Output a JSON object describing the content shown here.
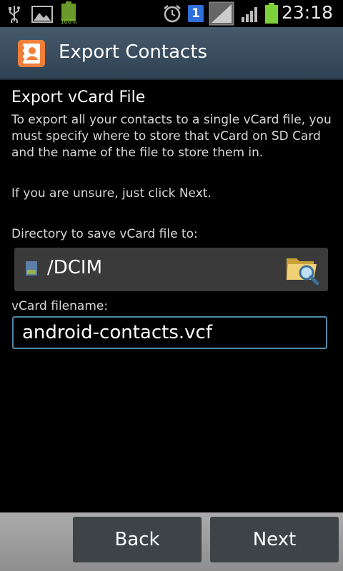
{
  "status_bar": {
    "time": "23:18",
    "battery_level": "100%",
    "notification_count": "1",
    "icons": [
      "usb-icon",
      "image-icon",
      "battery-notification-icon",
      "alarm-icon",
      "notification-badge-icon",
      "wifi-icon",
      "signal-icon",
      "battery-icon"
    ]
  },
  "header": {
    "title": "Export Contacts",
    "icon": "contacts-app-icon",
    "accent_color": "#f07f3c"
  },
  "main": {
    "heading": "Export vCard File",
    "description": "To export all your contacts to a single vCard file, you must specify where to store that vCard on SD Card and the name of the file to store them in.",
    "hint": "If you are unsure, just click Next.",
    "directory_label": "Directory to save vCard file to:",
    "directory_value": "/DCIM",
    "filename_label": "vCard filename:",
    "filename_value": "android-contacts.vcf"
  },
  "buttons": {
    "back": "Back",
    "next": "Next"
  }
}
